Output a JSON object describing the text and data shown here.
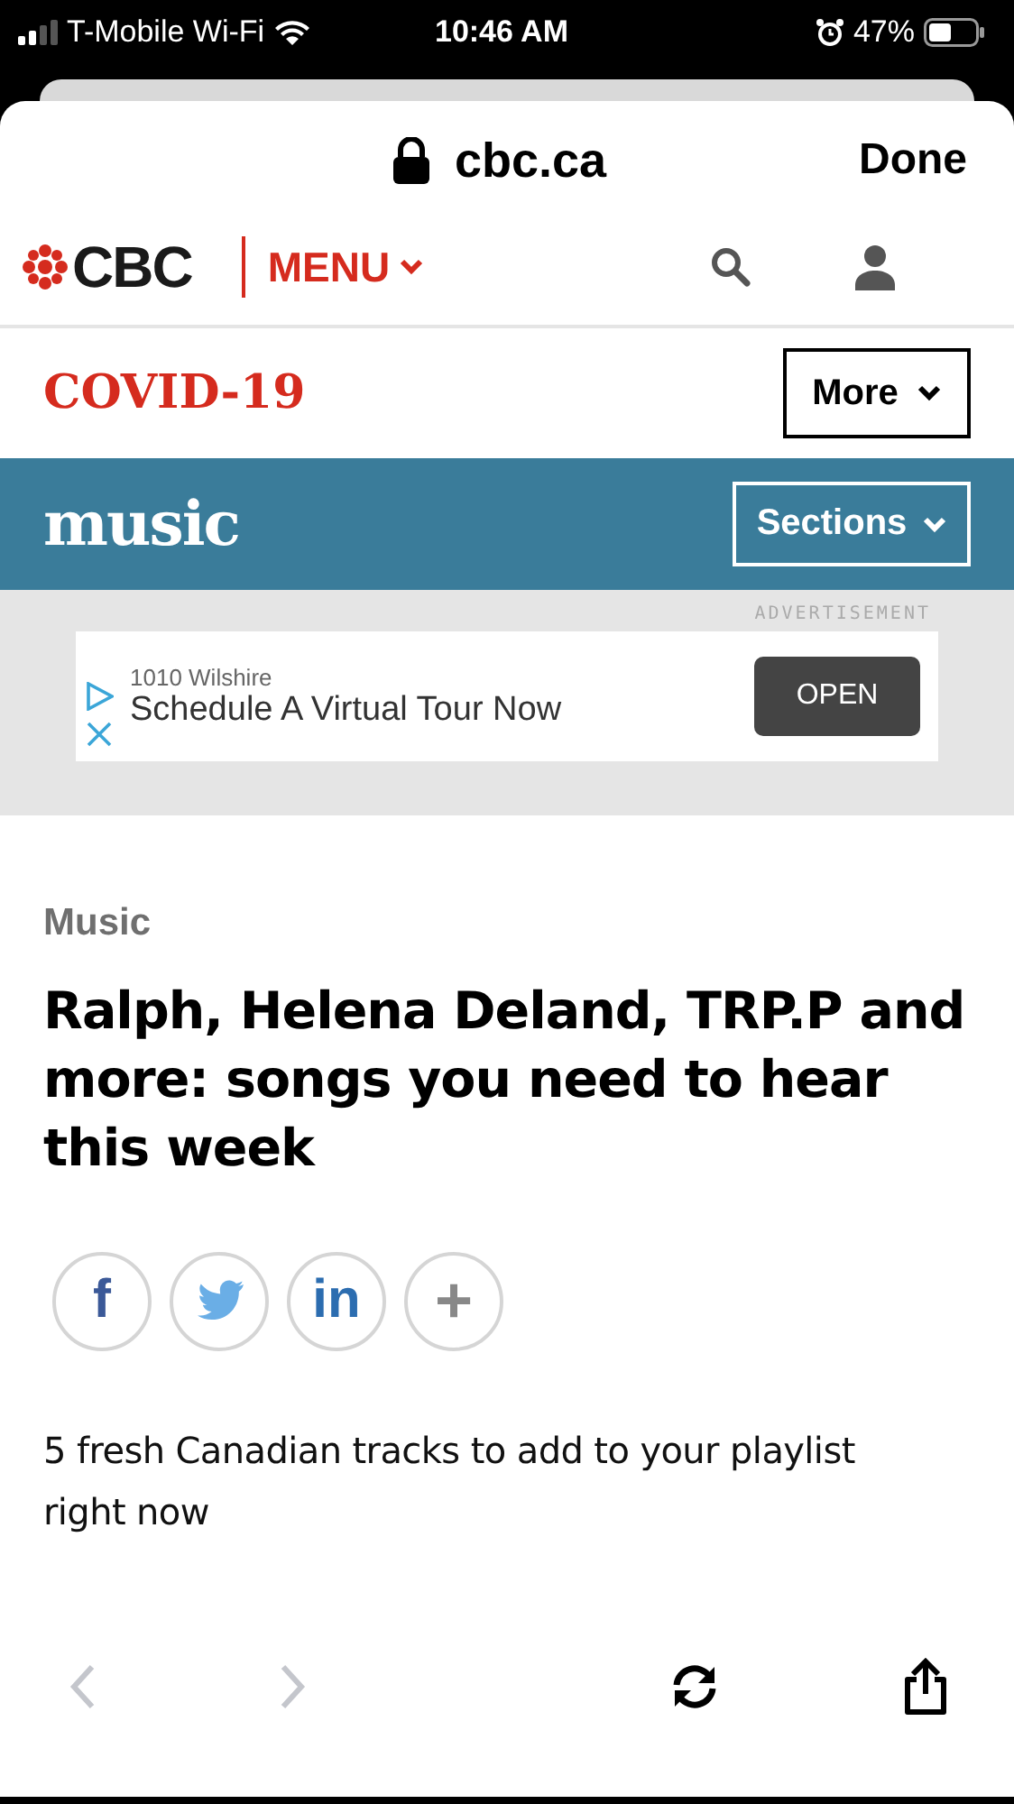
{
  "status_bar": {
    "carrier": "T-Mobile Wi-Fi",
    "time": "10:46 AM",
    "battery": "47%"
  },
  "browser": {
    "url": "cbc.ca",
    "done": "Done"
  },
  "header": {
    "logo": "CBC",
    "menu": "MENU"
  },
  "topic_bar": {
    "title": "COVID-19",
    "more": "More"
  },
  "section_bar": {
    "title": "music",
    "sections": "Sections"
  },
  "ad": {
    "label": "ADVERTISEMENT",
    "advertiser": "1010 Wilshire",
    "headline": "Schedule A Virtual Tour Now",
    "cta": "OPEN"
  },
  "article": {
    "category": "Music",
    "headline": "Ralph, Helena Deland, TRP.P and more: songs you need to hear this week",
    "summary": "5 fresh Canadian tracks to add to your playlist right now"
  },
  "share": [
    {
      "kind": "facebook",
      "label": "f"
    },
    {
      "kind": "twitter"
    },
    {
      "kind": "linkedin",
      "label": "in"
    },
    {
      "kind": "more",
      "label": "+"
    }
  ],
  "toolbar": {
    "back_disabled": true,
    "forward_disabled": true
  }
}
